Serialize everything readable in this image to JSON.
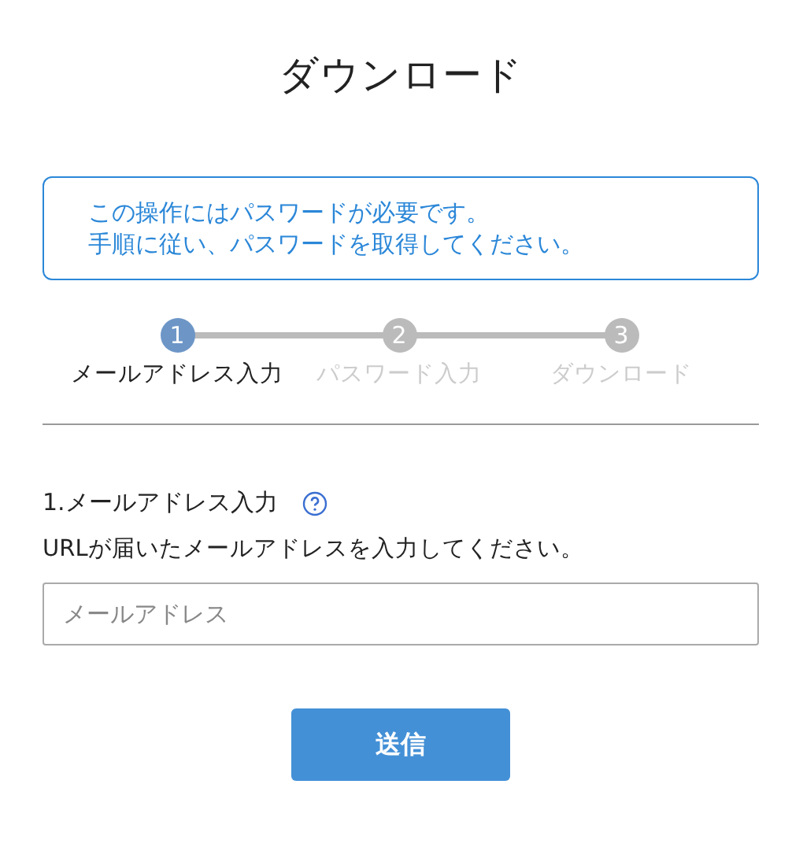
{
  "title": "ダウンロード",
  "notice": [
    "この操作にはパスワードが必要です。",
    "手順に従い、パスワードを取得してください。"
  ],
  "steps": [
    {
      "number": "1",
      "label": "メールアドレス入力",
      "selected": true
    },
    {
      "number": "2",
      "label": "パスワード入力",
      "selected": false
    },
    {
      "number": "3",
      "label": "ダウンロード",
      "selected": false
    }
  ],
  "section": {
    "heading": "1.メールアドレス入力",
    "description": "URLが届いたメールアドレスを入力してください。"
  },
  "email_field": {
    "placeholder": "メールアドレス"
  },
  "submit_button": "送信"
}
